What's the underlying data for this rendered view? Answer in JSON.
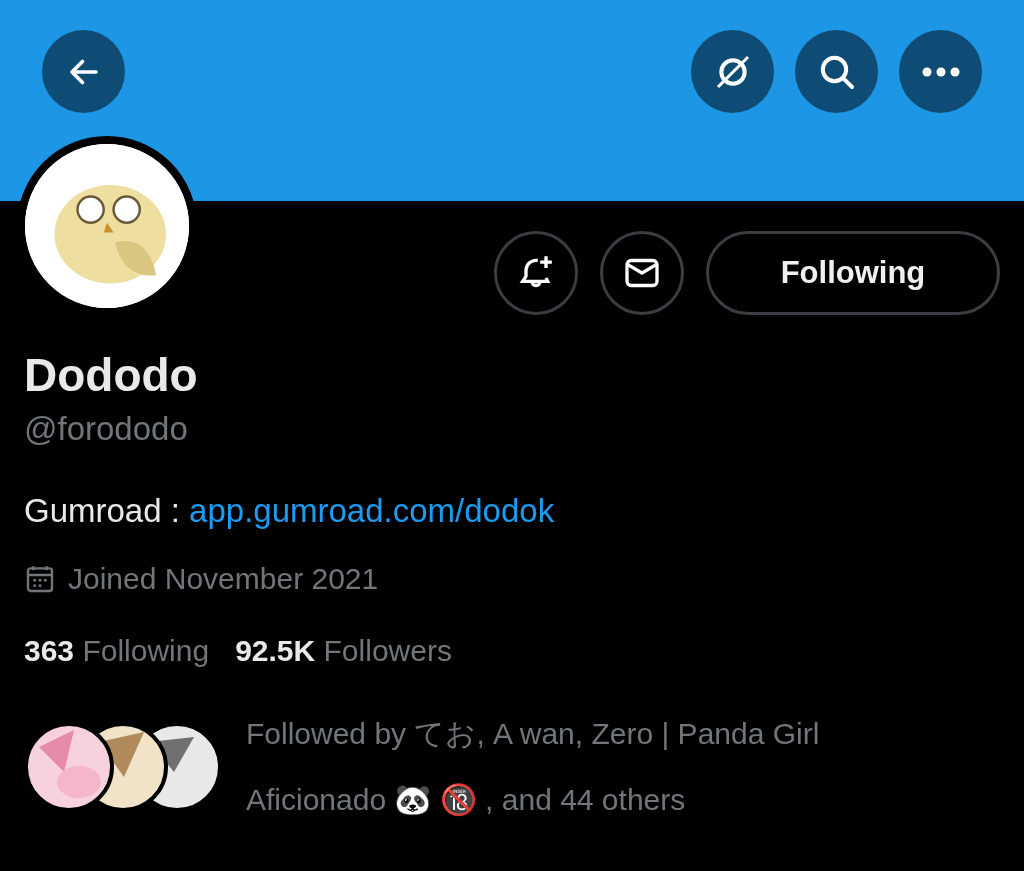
{
  "profile": {
    "name": "Dododo",
    "handle": "@forododo",
    "bio_label": "Gumroad : ",
    "bio_link": "app.gumroad.com/dodok",
    "joined": "Joined November 2021"
  },
  "follow_button": "Following",
  "stats": [
    {
      "count": "363",
      "label": "Following"
    },
    {
      "count": "92.5K",
      "label": "Followers"
    }
  ],
  "followed_by": "Followed by てお, A wan, Zero | Panda Girl Aficionado 🐼 🔞 , and 44 others"
}
